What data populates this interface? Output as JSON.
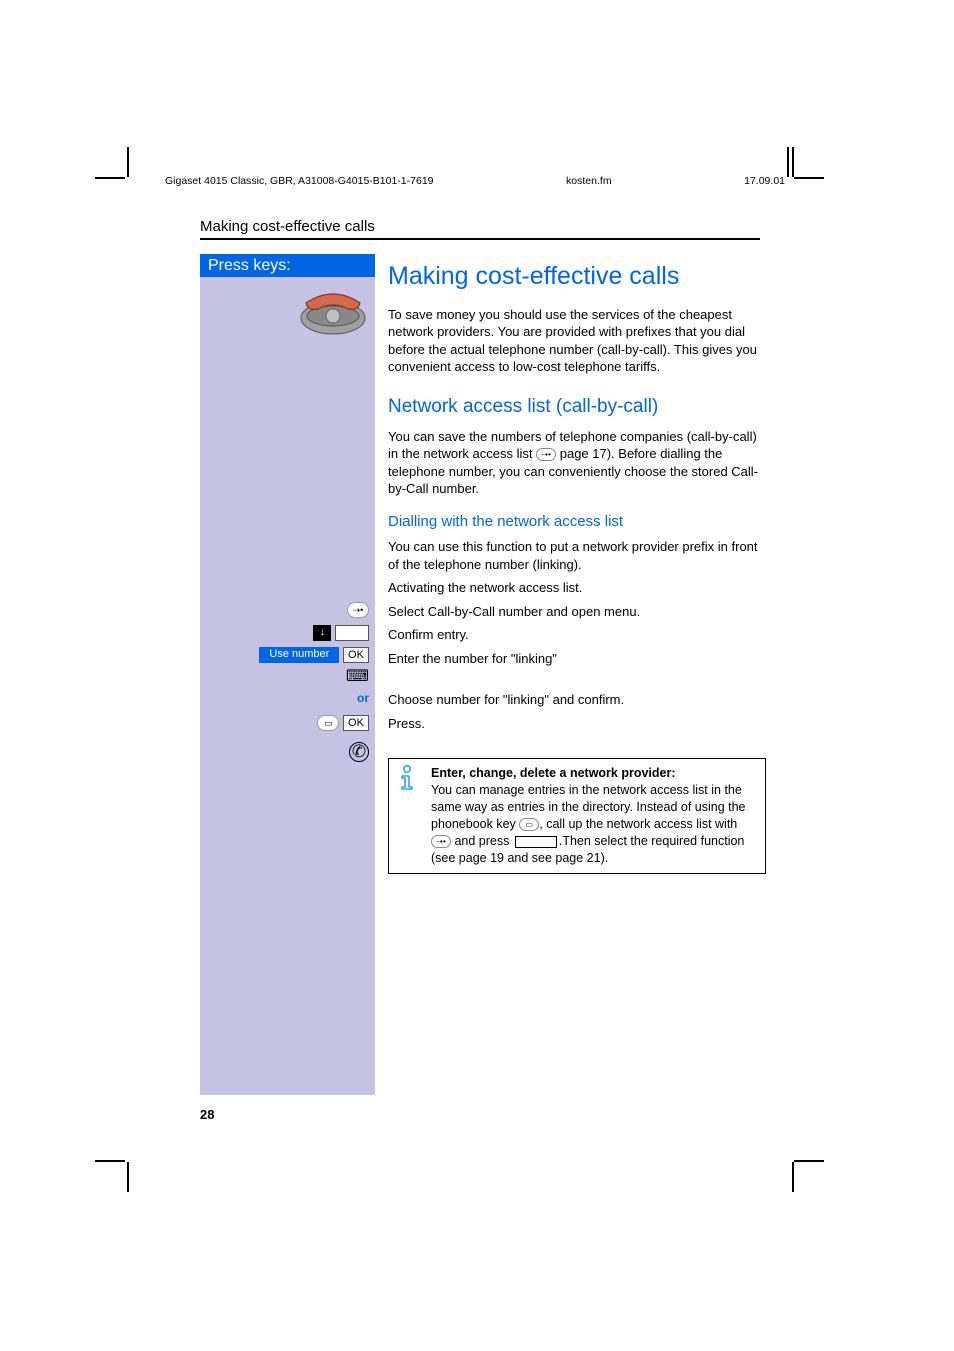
{
  "meta": {
    "product": "Gigaset 4015 Classic, GBR, A31008-G4015-B101-1-7619",
    "file": "kosten.fm",
    "date": "17.09.01"
  },
  "running_head": "Making cost-effective calls",
  "press_keys_label": "Press keys:",
  "h1": "Making cost-effective calls",
  "intro": "To save money you should use the services of the cheapest network providers. You are provided with prefixes that you dial before the actual telephone number (call-by-call). This gives you convenient access to low-cost telephone tariffs.",
  "h2": "Network access list (call-by-call)",
  "net_intro_a": "You can save the numbers of telephone companies (call-by-call) in the network access list ",
  "net_intro_b": " page 17). Before dialling the telephone number, you can conveniently choose the stored Call-by-Call number.",
  "h3": "Dialling with the network access list",
  "dial_intro": "You can use this function to put a network provider prefix in front of the telephone number (linking).",
  "steps": {
    "s1": "Activating the network access list.",
    "s2": "Select Call-by-Call number and open menu.",
    "s3_label": "Use number",
    "s3": "Confirm entry.",
    "s4": "Enter the number for \"linking\"",
    "or": "or",
    "s5": "Choose number for \"linking\" and confirm.",
    "s6": "Press.",
    "ok": "OK"
  },
  "info": {
    "title": "Enter, change, delete a network provider:",
    "body_a": "You can manage entries in the network access list in the same way as entries in the directory. Instead of using the phonebook key ",
    "body_b": ", call up the network access list with ",
    "body_c": " and press ",
    "body_d": ".Then select the required function (see page 19 and see page 21)."
  },
  "page_number": "28"
}
